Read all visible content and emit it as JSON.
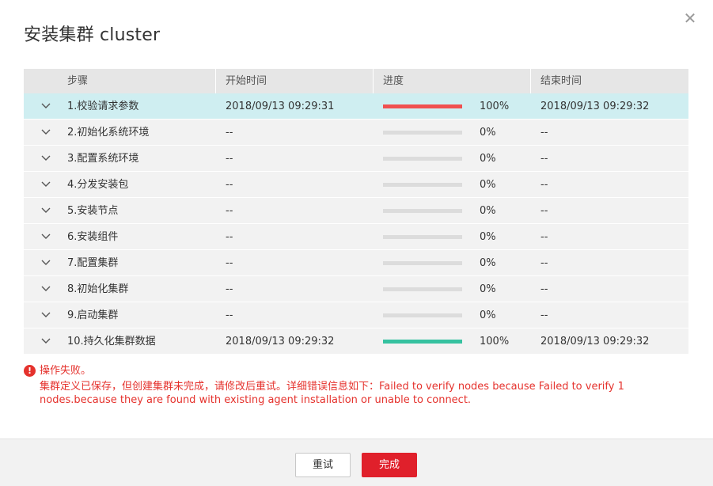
{
  "dialog": {
    "title": "安装集群 cluster",
    "close_icon": "close-icon"
  },
  "table": {
    "headers": [
      "步骤",
      "开始时间",
      "进度",
      "结束时间"
    ],
    "rows": [
      {
        "step": "1.校验请求参数",
        "start": "2018/09/13 09:29:31",
        "progress": 100,
        "progress_label": "100%",
        "bar_color": "#f05050",
        "end": "2018/09/13 09:29:32"
      },
      {
        "step": "2.初始化系统环境",
        "start": "--",
        "progress": 0,
        "progress_label": "0%",
        "bar_color": "#dcdcdc",
        "end": "--"
      },
      {
        "step": "3.配置系统环境",
        "start": "--",
        "progress": 0,
        "progress_label": "0%",
        "bar_color": "#dcdcdc",
        "end": "--"
      },
      {
        "step": "4.分发安装包",
        "start": "--",
        "progress": 0,
        "progress_label": "0%",
        "bar_color": "#dcdcdc",
        "end": "--"
      },
      {
        "step": "5.安装节点",
        "start": "--",
        "progress": 0,
        "progress_label": "0%",
        "bar_color": "#dcdcdc",
        "end": "--"
      },
      {
        "step": "6.安装组件",
        "start": "--",
        "progress": 0,
        "progress_label": "0%",
        "bar_color": "#dcdcdc",
        "end": "--"
      },
      {
        "step": "7.配置集群",
        "start": "--",
        "progress": 0,
        "progress_label": "0%",
        "bar_color": "#dcdcdc",
        "end": "--"
      },
      {
        "step": "8.初始化集群",
        "start": "--",
        "progress": 0,
        "progress_label": "0%",
        "bar_color": "#dcdcdc",
        "end": "--"
      },
      {
        "step": "9.启动集群",
        "start": "--",
        "progress": 0,
        "progress_label": "0%",
        "bar_color": "#dcdcdc",
        "end": "--"
      },
      {
        "step": "10.持久化集群数据",
        "start": "2018/09/13 09:29:32",
        "progress": 100,
        "progress_label": "100%",
        "bar_color": "#36c2a0",
        "end": "2018/09/13 09:29:32"
      }
    ]
  },
  "error": {
    "icon": "exclamation-icon",
    "title": "操作失败。",
    "message": "集群定义已保存，但创建集群未完成，请修改后重试。详细错误信息如下：Failed to verify nodes because Failed to verify 1 nodes.because they are found with existing agent installation or unable to connect."
  },
  "footer": {
    "retry_label": "重试",
    "done_label": "完成"
  },
  "colors": {
    "accent": "#e0202b",
    "error": "#e5322d",
    "active_row": "#cfeef1"
  }
}
